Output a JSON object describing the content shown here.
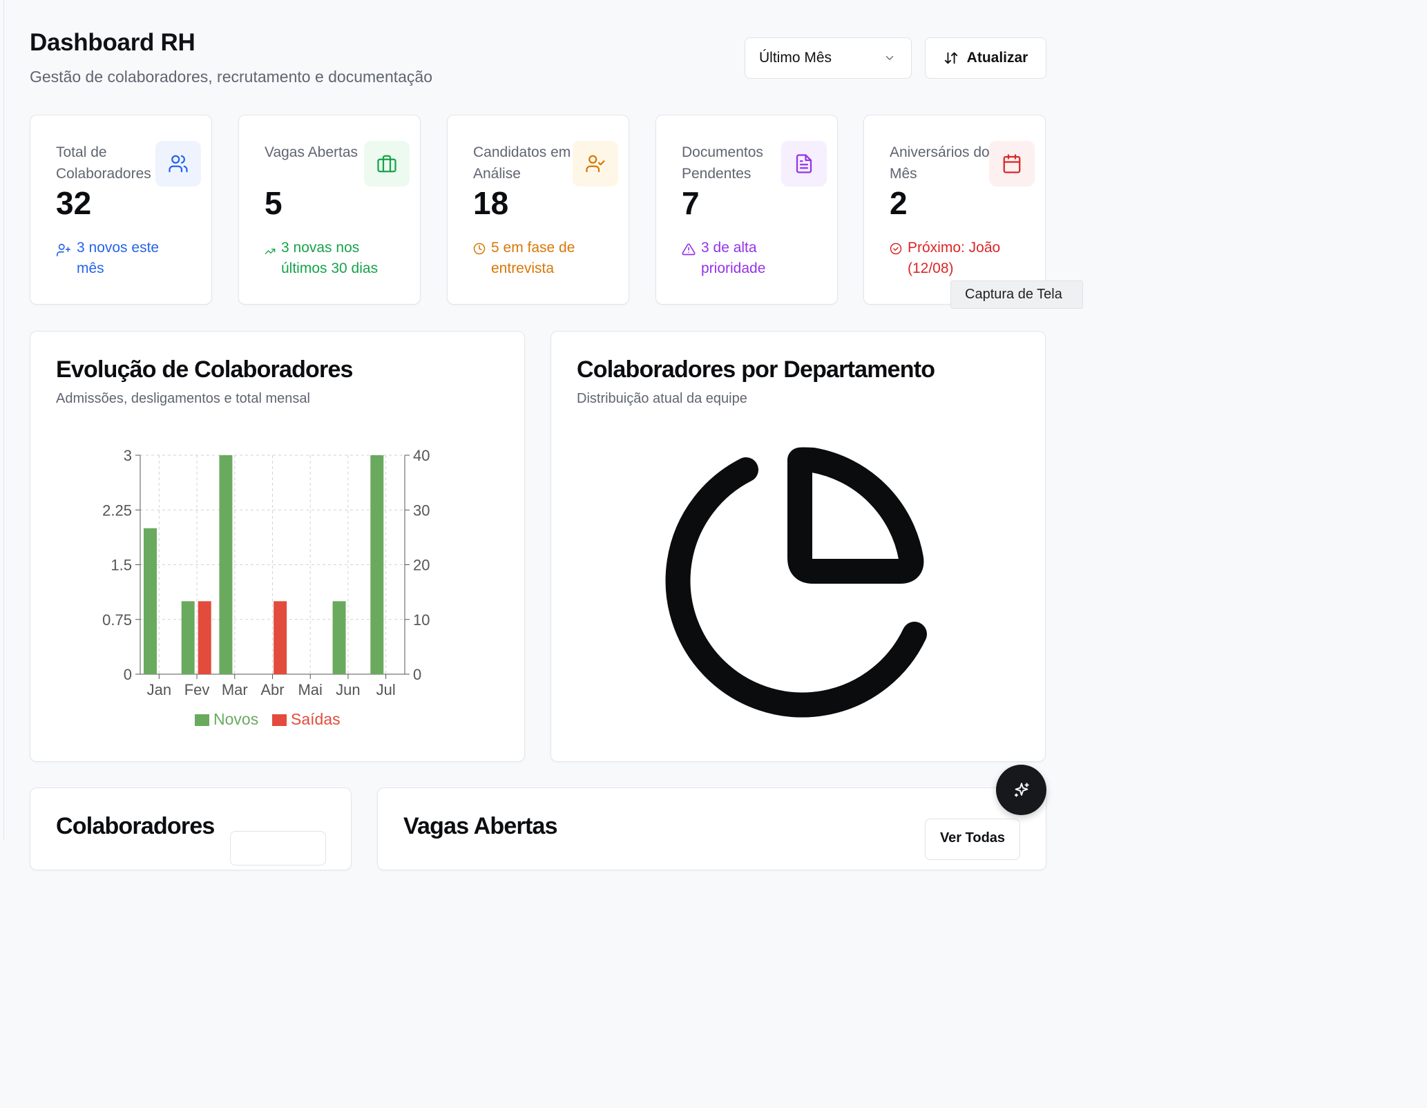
{
  "header": {
    "title": "Dashboard RH",
    "subtitle": "Gestão de colaboradores, recrutamento e documentação",
    "period_select": "Último Mês",
    "refresh_label": "Atualizar"
  },
  "stats": [
    {
      "label": "Total de Colaboradores",
      "value": "32",
      "footnote": "3 novos este mês",
      "icon": "users-icon",
      "color": "#2563eb",
      "bg": "#eef3fe"
    },
    {
      "label": "Vagas Abertas",
      "value": "5",
      "footnote": "3 novas nos últimos 30 dias",
      "icon": "briefcase-icon",
      "color": "#16a34a",
      "bg": "#edfaf0"
    },
    {
      "label": "Candidatos em Análise",
      "value": "18",
      "footnote": "5 em fase de entrevista",
      "icon": "user-check-icon",
      "color": "#d97706",
      "bg": "#fef7e8"
    },
    {
      "label": "Documentos Pendentes",
      "value": "7",
      "footnote": "3 de alta prioridade",
      "icon": "file-text-icon",
      "color": "#9333ea",
      "bg": "#f6effe"
    },
    {
      "label": "Aniversários do Mês",
      "value": "2",
      "footnote": "Próximo: João (12/08)",
      "icon": "calendar-icon",
      "color": "#dc2626",
      "bg": "#fdf0f0"
    }
  ],
  "tooltip": "Captura de Tela",
  "evolution": {
    "title": "Evolução de Colaboradores",
    "subtitle": "Admissões, desligamentos e total mensal"
  },
  "department": {
    "title": "Colaboradores por Departamento",
    "subtitle": "Distribuição atual da equipe"
  },
  "bottom": {
    "left_title": "Colaboradores",
    "right_title": "Vagas Abertas",
    "right_button": "Ver Todas"
  },
  "chart_data": {
    "type": "bar",
    "categories": [
      "Jan",
      "Fev",
      "Mar",
      "Abr",
      "Mai",
      "Jun",
      "Jul"
    ],
    "series": [
      {
        "name": "Novos",
        "values": [
          2,
          1,
          3,
          0,
          0,
          1,
          3
        ],
        "color": "#6aaa5f"
      },
      {
        "name": "Saídas",
        "values": [
          0,
          1,
          0,
          1,
          0,
          0,
          0
        ],
        "color": "#e34b3d"
      }
    ],
    "ylim": [
      0,
      3
    ],
    "yticks": [
      "0",
      "0.75",
      "1.5",
      "2.25",
      "3"
    ],
    "y2lim": [
      0,
      40
    ],
    "y2ticks": [
      "0",
      "10",
      "20",
      "30",
      "40"
    ],
    "grid": true,
    "legend": "bottom"
  }
}
